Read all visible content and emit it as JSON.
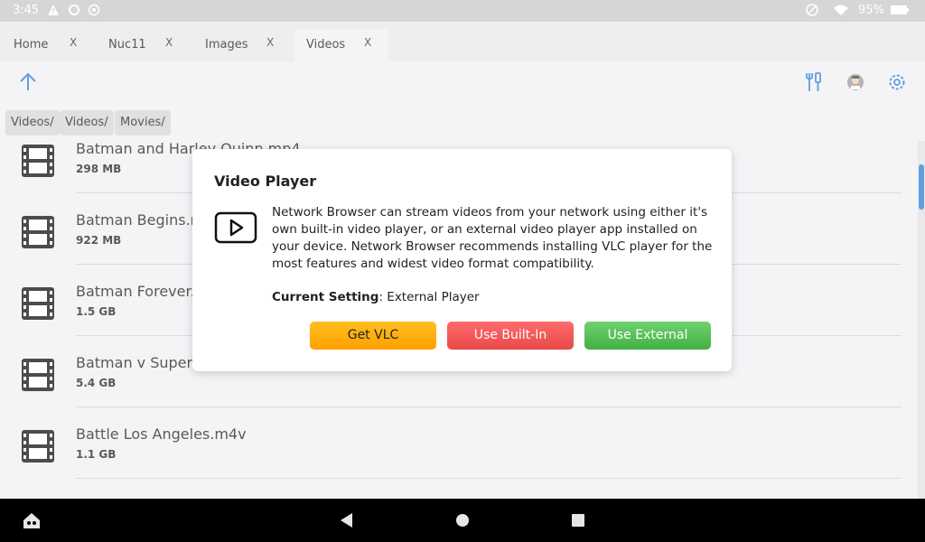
{
  "status": {
    "time": "3:45",
    "battery": "95%"
  },
  "tabs": [
    {
      "label": "Home",
      "close": "X"
    },
    {
      "label": "Nuc11",
      "close": "X"
    },
    {
      "label": "Images",
      "close": "X"
    },
    {
      "label": "Videos",
      "close": "X",
      "active": true
    }
  ],
  "breadcrumbs": [
    "Videos/",
    "Videos/",
    "Movies/"
  ],
  "files": [
    {
      "name": "Batman and Harley Quinn.mp4",
      "size": "298 MB"
    },
    {
      "name": "Batman Begins.m4v",
      "size": "922 MB"
    },
    {
      "name": "Batman Forever.m4v",
      "size": "1.5 GB"
    },
    {
      "name": "Batman v Superman.m4v",
      "size": "5.4 GB"
    },
    {
      "name": "Battle Los Angeles.m4v",
      "size": "1.1 GB"
    }
  ],
  "dialog": {
    "title": "Video Player",
    "body": "Network Browser can stream videos from your network using either it's own built-in video player, or an external video player app installed on your device. Network Browser recommends installing VLC player for the most features and widest video format compatibility.",
    "setting_label": "Current Setting",
    "setting_value": ": External Player",
    "buttons": {
      "vlc": "Get VLC",
      "builtin": "Use Built-In",
      "external": "Use External"
    }
  },
  "colors": {
    "accent": "#2a7fd6",
    "vlc": "#ffb000",
    "builtin": "#f05a5a",
    "external": "#58c058"
  }
}
